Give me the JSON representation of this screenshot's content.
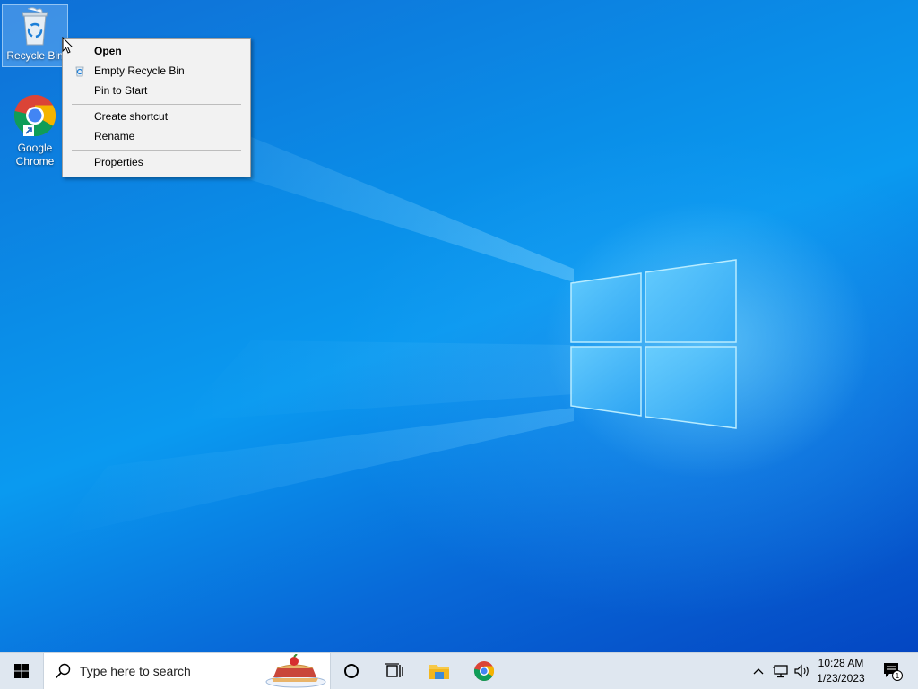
{
  "desktop": {
    "icons": [
      {
        "label": "Recycle Bin"
      },
      {
        "label": "Google Chrome"
      }
    ]
  },
  "context_menu": {
    "items": [
      {
        "label": "Open",
        "bold": true
      },
      {
        "label": "Empty Recycle Bin"
      },
      {
        "label": "Pin to Start"
      },
      {
        "label": "Create shortcut"
      },
      {
        "label": "Rename"
      },
      {
        "label": "Properties"
      }
    ]
  },
  "taskbar": {
    "search_placeholder": "Type here to search",
    "clock": {
      "time": "10:28 AM",
      "date": "1/23/2023"
    },
    "notification_count": "1"
  },
  "colors": {
    "desktop_blue": "#0a8ee8",
    "taskbar_bg": "#dfe7f0",
    "menu_bg": "#f2f2f2"
  }
}
